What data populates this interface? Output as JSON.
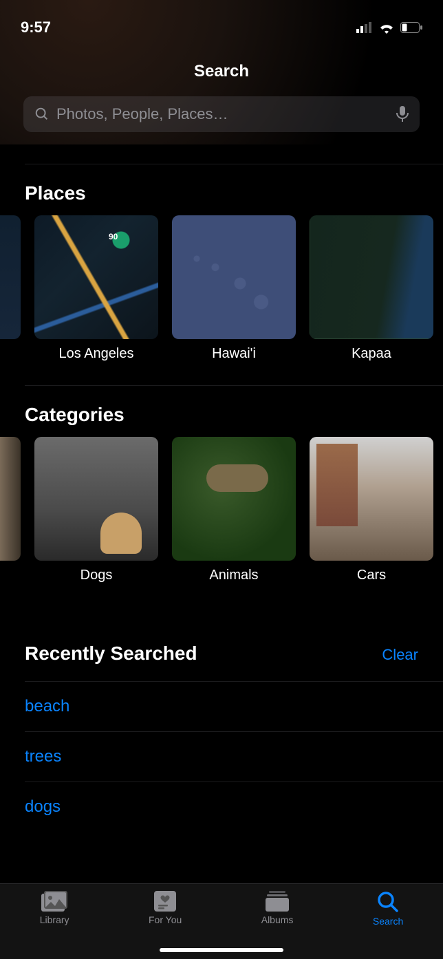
{
  "status": {
    "time": "9:57"
  },
  "header": {
    "title": "Search"
  },
  "search": {
    "placeholder": "Photos, People, Places…",
    "value": ""
  },
  "places": {
    "title": "Places",
    "items": [
      {
        "label": "Los Angeles"
      },
      {
        "label": "Hawai'i"
      },
      {
        "label": "Kapaa"
      }
    ]
  },
  "categories": {
    "title": "Categories",
    "items": [
      {
        "label": "Dogs"
      },
      {
        "label": "Animals"
      },
      {
        "label": "Cars"
      }
    ]
  },
  "recent": {
    "title": "Recently Searched",
    "clear": "Clear",
    "items": [
      {
        "label": "beach"
      },
      {
        "label": "trees"
      },
      {
        "label": "dogs"
      }
    ]
  },
  "tabs": {
    "library": "Library",
    "foryou": "For You",
    "albums": "Albums",
    "search": "Search"
  }
}
